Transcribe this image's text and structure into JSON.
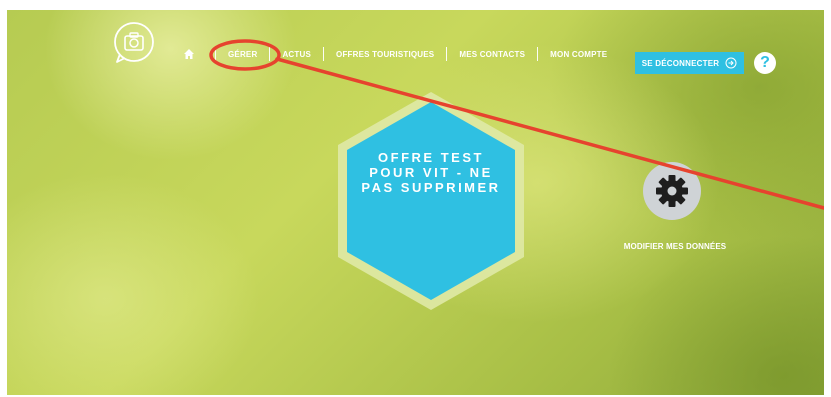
{
  "nav": {
    "items": [
      {
        "label": "GÉRER"
      },
      {
        "label": "ACTUS"
      },
      {
        "label": "OFFRES TOURISTIQUES"
      },
      {
        "label": "MES CONTACTS"
      },
      {
        "label": "MON COMPTE"
      }
    ]
  },
  "header": {
    "logout_label": "SE DÉCONNECTER",
    "help_label": "?"
  },
  "offer": {
    "title": "OFFRE TEST POUR VIT - NE PAS SUPPRIMER"
  },
  "settings": {
    "label": "MODIFIER MES DONNÉES"
  },
  "colors": {
    "accent": "#2fc0e2",
    "annotation": "#e6432e",
    "hexagon_border": "#dfe9a6"
  },
  "icons": [
    "logo-camera-icon",
    "home-icon",
    "arrow-right-circle-icon",
    "gear-icon"
  ]
}
